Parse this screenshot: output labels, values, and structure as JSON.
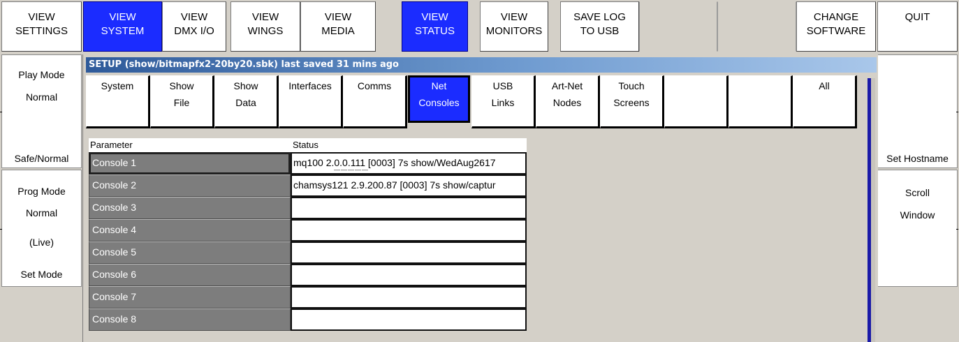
{
  "top_buttons": [
    {
      "label": "VIEW\nSETTINGS",
      "active": false
    },
    {
      "label": "VIEW\nSYSTEM",
      "active": true
    },
    {
      "label": "VIEW\nDMX I/O",
      "active": false
    },
    {
      "label": "VIEW\nWINGS",
      "active": false
    },
    {
      "label": "VIEW\nMEDIA",
      "active": false
    },
    {
      "label": "VIEW\nSTATUS",
      "active": true
    },
    {
      "label": "VIEW\nMONITORS",
      "active": false
    },
    {
      "label": "SAVE LOG\nTO USB",
      "active": false
    },
    {
      "label": "",
      "active": false
    },
    {
      "label": "",
      "active": false
    },
    {
      "label": "CHANGE\nSOFTWARE",
      "active": false
    },
    {
      "label": "QUIT",
      "active": false
    }
  ],
  "left_panel": {
    "play_mode_label": "Play Mode",
    "play_mode_value": "Normal",
    "safe_normal": "Safe/Normal",
    "prog_mode_label": "Prog Mode",
    "prog_mode_value": "Normal",
    "prog_mode_live": "(Live)",
    "set_mode": "Set Mode"
  },
  "right_panel": {
    "set_hostname": "Set Hostname",
    "scroll_line1": "Scroll",
    "scroll_line2": "Window"
  },
  "window": {
    "title": "SETUP (show/bitmapfx2-20by20.sbk) last saved 31 mins ago",
    "tabs": [
      {
        "line1": "System",
        "line2": ""
      },
      {
        "line1": "Show",
        "line2": "File"
      },
      {
        "line1": "Show",
        "line2": "Data"
      },
      {
        "line1": "Interfaces",
        "line2": ""
      },
      {
        "line1": "Comms",
        "line2": ""
      },
      {
        "line1": "Net",
        "line2": "Consoles"
      },
      {
        "line1": "USB",
        "line2": "Links"
      },
      {
        "line1": "Art-Net",
        "line2": "Nodes"
      },
      {
        "line1": "Touch",
        "line2": "Screens"
      },
      {
        "line1": "",
        "line2": ""
      },
      {
        "line1": "",
        "line2": ""
      },
      {
        "line1": "All",
        "line2": ""
      }
    ],
    "active_tab_index": 5,
    "table": {
      "header_parameter": "Parameter",
      "header_status": "Status",
      "rows": [
        {
          "name": "Console 1",
          "status": "mq100 2.0.0.111 [0003] 7s show/WedAug2617",
          "selected": true
        },
        {
          "name": "Console 2",
          "status": "chamsys121 2.9.200.87 [0003] 7s show/captur",
          "selected": false
        },
        {
          "name": "Console 3",
          "status": "",
          "selected": false
        },
        {
          "name": "Console 4",
          "status": "",
          "selected": false
        },
        {
          "name": "Console 5",
          "status": "",
          "selected": false
        },
        {
          "name": "Console 6",
          "status": "",
          "selected": false
        },
        {
          "name": "Console 7",
          "status": "",
          "selected": false
        },
        {
          "name": "Console 8",
          "status": "",
          "selected": false
        }
      ]
    }
  },
  "colors": {
    "active_blue": "#1b2cff",
    "panel_grey": "#d4d0c8",
    "param_cell": "#7d7d7d",
    "scroll_blue": "#1a1aa8"
  }
}
